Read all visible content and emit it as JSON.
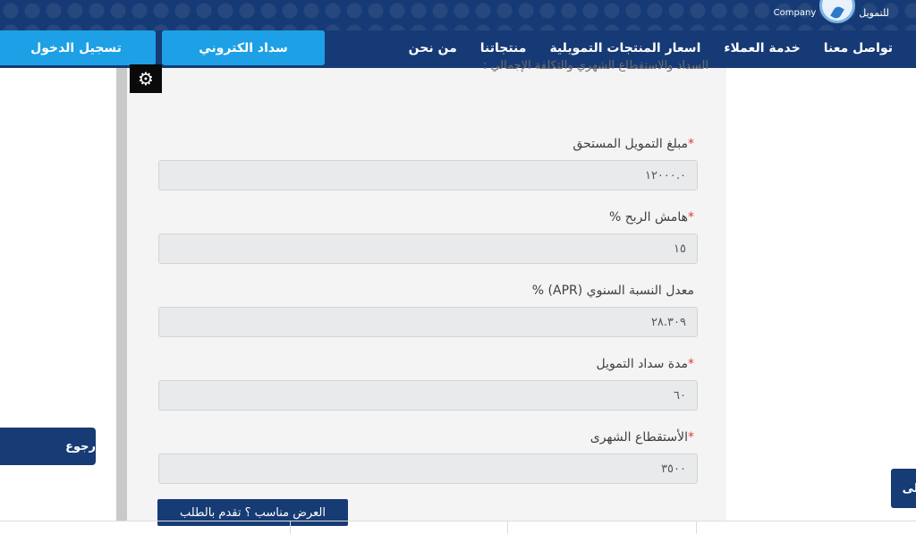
{
  "header": {
    "logo_company": "Company",
    "logo_arabic": "للتمويل"
  },
  "nav": {
    "items": [
      "من نحن",
      "منتجاتنا",
      "اسعار المنتجات التمويلية",
      "خدمة العملاء",
      "تواصل معنا"
    ]
  },
  "buttons": {
    "pay": "سداد الكتروني",
    "login": "تسجيل الدخول",
    "submit": "العرض مناسب ؟ تقدم بالطلب",
    "back": "رجوع",
    "side": "على"
  },
  "form": {
    "intro": "السداد والاستقطاع الشهري والتكلفة الإجمالي :",
    "fields": [
      {
        "label": "مبلغ التمويل المستحق",
        "required": "*",
        "value": "١٢٠٠٠.٠"
      },
      {
        "label": "هامش الربح %",
        "required": "*",
        "value": "١٥"
      },
      {
        "label": "معدل النسبة السنوي (APR) %",
        "required": "",
        "value": "٢٨.٣٠٩"
      },
      {
        "label": "مدة سداد التمويل",
        "required": "*",
        "value": "٦٠"
      },
      {
        "label": "الأستقطاع الشهرى",
        "required": "*",
        "value": "٣٥٠٠"
      }
    ]
  },
  "icons": {
    "settings": "gear-icon",
    "logo": "logo-icon"
  },
  "colors": {
    "header_bg": "#163a75",
    "accent_button": "#1da0e6",
    "dark_button": "#173b74",
    "required": "#e53935"
  }
}
